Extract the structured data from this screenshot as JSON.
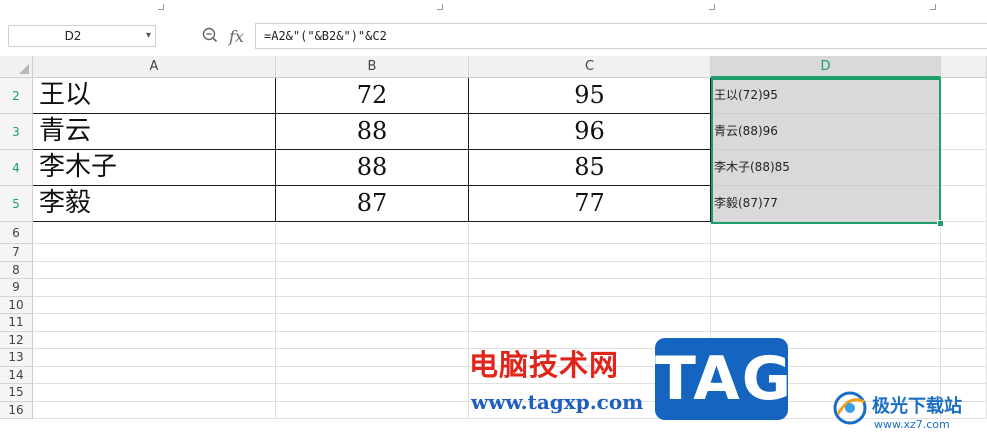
{
  "name_box": {
    "value": "D2"
  },
  "formula_bar": {
    "formula": "=A2&\"(\"&B2&\")\"&C2"
  },
  "columns": [
    "A",
    "B",
    "C",
    "D"
  ],
  "rows": [
    {
      "num": "2",
      "a": "王以",
      "b": "72",
      "c": "95",
      "d": "王以(72)95"
    },
    {
      "num": "3",
      "a": "青云",
      "b": "88",
      "c": "96",
      "d": "青云(88)96"
    },
    {
      "num": "4",
      "a": "李木子",
      "b": "88",
      "c": "85",
      "d": "李木子(88)85"
    },
    {
      "num": "5",
      "a": "李毅",
      "b": "87",
      "c": "77",
      "d": "李毅(87)77"
    }
  ],
  "empty_rows": [
    "6",
    "7",
    "8",
    "9",
    "10",
    "11",
    "12",
    "13",
    "14",
    "15",
    "16"
  ],
  "watermark": {
    "site_name": "电脑技术网",
    "site_url": "www.tagxp.com",
    "tag_logo": "TAG",
    "jg_name": "极光下载站",
    "jg_url": "www.xz7.com"
  },
  "colors": {
    "selection": "#1e9e6a",
    "selected_fill": "#d9d9d9",
    "watermark_red": "#e0261a",
    "watermark_blue": "#1565c0"
  },
  "icons": {
    "zoom": "zoom-icon",
    "fx": "fx-icon",
    "dropdown": "chevron-down-icon",
    "select_all": "select-all-corner-icon",
    "jg_logo": "jiguang-logo-icon"
  }
}
